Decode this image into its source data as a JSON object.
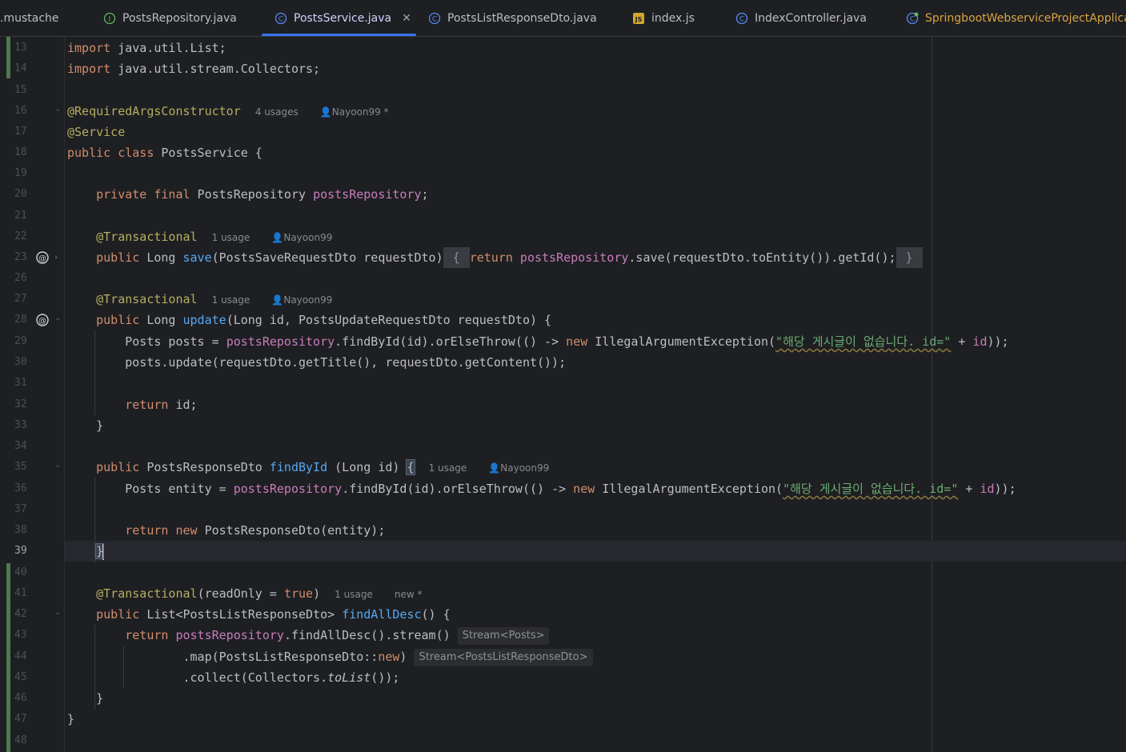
{
  "tabs": [
    {
      "label": ".mustache",
      "icon": "mustache-file-icon"
    },
    {
      "label": "PostsRepository.java",
      "icon": "interface-icon"
    },
    {
      "label": "PostsService.java",
      "icon": "class-icon",
      "active": true
    },
    {
      "label": "PostsListResponseDto.java",
      "icon": "class-icon"
    },
    {
      "label": "index.js",
      "icon": "js-file-icon"
    },
    {
      "label": "IndexController.java",
      "icon": "class-icon"
    },
    {
      "label": "SpringbootWebserviceProjectApplica",
      "icon": "spring-app-icon"
    }
  ],
  "close_glyph": "✕",
  "hints": {
    "usages_4": "4 usages",
    "usage_1": "1 usage",
    "author": "Nayoon99",
    "author_mod": "Nayoon99 *",
    "new_mod": "new *"
  },
  "inlay": {
    "stream_posts": "Stream<Posts>",
    "stream_dto": "Stream<PostsListResponseDto>"
  },
  "lines": [
    {
      "num": "13",
      "text": "import java.util.List;"
    },
    {
      "num": "14",
      "text": "import java.util.stream.Collectors;"
    },
    {
      "num": "15",
      "text": ""
    },
    {
      "num": "16",
      "text": "@RequiredArgsConstructor"
    },
    {
      "num": "17",
      "text": "@Service"
    },
    {
      "num": "18",
      "text": "public class PostsService {"
    },
    {
      "num": "19",
      "text": ""
    },
    {
      "num": "20",
      "text": "private final PostsRepository postsRepository;"
    },
    {
      "num": "21",
      "text": ""
    },
    {
      "num": "22",
      "text": "@Transactional"
    },
    {
      "num": "23",
      "text": "public Long save(PostsSaveRequestDto requestDto) { return postsRepository.save(requestDto.toEntity()).getId(); }"
    },
    {
      "num": "26",
      "text": ""
    },
    {
      "num": "27",
      "text": "@Transactional"
    },
    {
      "num": "28",
      "text": "public Long update(Long id, PostsUpdateRequestDto requestDto) {"
    },
    {
      "num": "29",
      "text": "Posts posts = postsRepository.findById(id).orElseThrow(() -> new IllegalArgumentException(\"해당 게시글이 없습니다. id=\" + id));"
    },
    {
      "num": "30",
      "text": "posts.update(requestDto.getTitle(), requestDto.getContent());"
    },
    {
      "num": "31",
      "text": ""
    },
    {
      "num": "32",
      "text": "return id;"
    },
    {
      "num": "33",
      "text": "}"
    },
    {
      "num": "34",
      "text": ""
    },
    {
      "num": "35",
      "text": "public PostsResponseDto findById (Long id) {"
    },
    {
      "num": "36",
      "text": "Posts entity = postsRepository.findById(id).orElseThrow(() -> new IllegalArgumentException(\"해당 게시글이 없습니다. id=\" + id));"
    },
    {
      "num": "37",
      "text": ""
    },
    {
      "num": "38",
      "text": "return new PostsResponseDto(entity);"
    },
    {
      "num": "39",
      "text": "}"
    },
    {
      "num": "40",
      "text": ""
    },
    {
      "num": "41",
      "text": "@Transactional(readOnly = true)"
    },
    {
      "num": "42",
      "text": "public List<PostsListResponseDto> findAllDesc() {"
    },
    {
      "num": "43",
      "text": "return postsRepository.findAllDesc().stream()"
    },
    {
      "num": "44",
      "text": ".map(PostsListResponseDto::new)"
    },
    {
      "num": "45",
      "text": ".collect(Collectors.toList());"
    },
    {
      "num": "46",
      "text": "}"
    },
    {
      "num": "47",
      "text": "}"
    },
    {
      "num": "48",
      "text": ""
    }
  ],
  "colors": {
    "background": "#1e1f22",
    "keyword": "#cf8e6d",
    "annotation": "#b3ae60",
    "field": "#c77dbb",
    "method": "#56a8f5",
    "string": "#6aab73",
    "accent": "#3574f0"
  }
}
